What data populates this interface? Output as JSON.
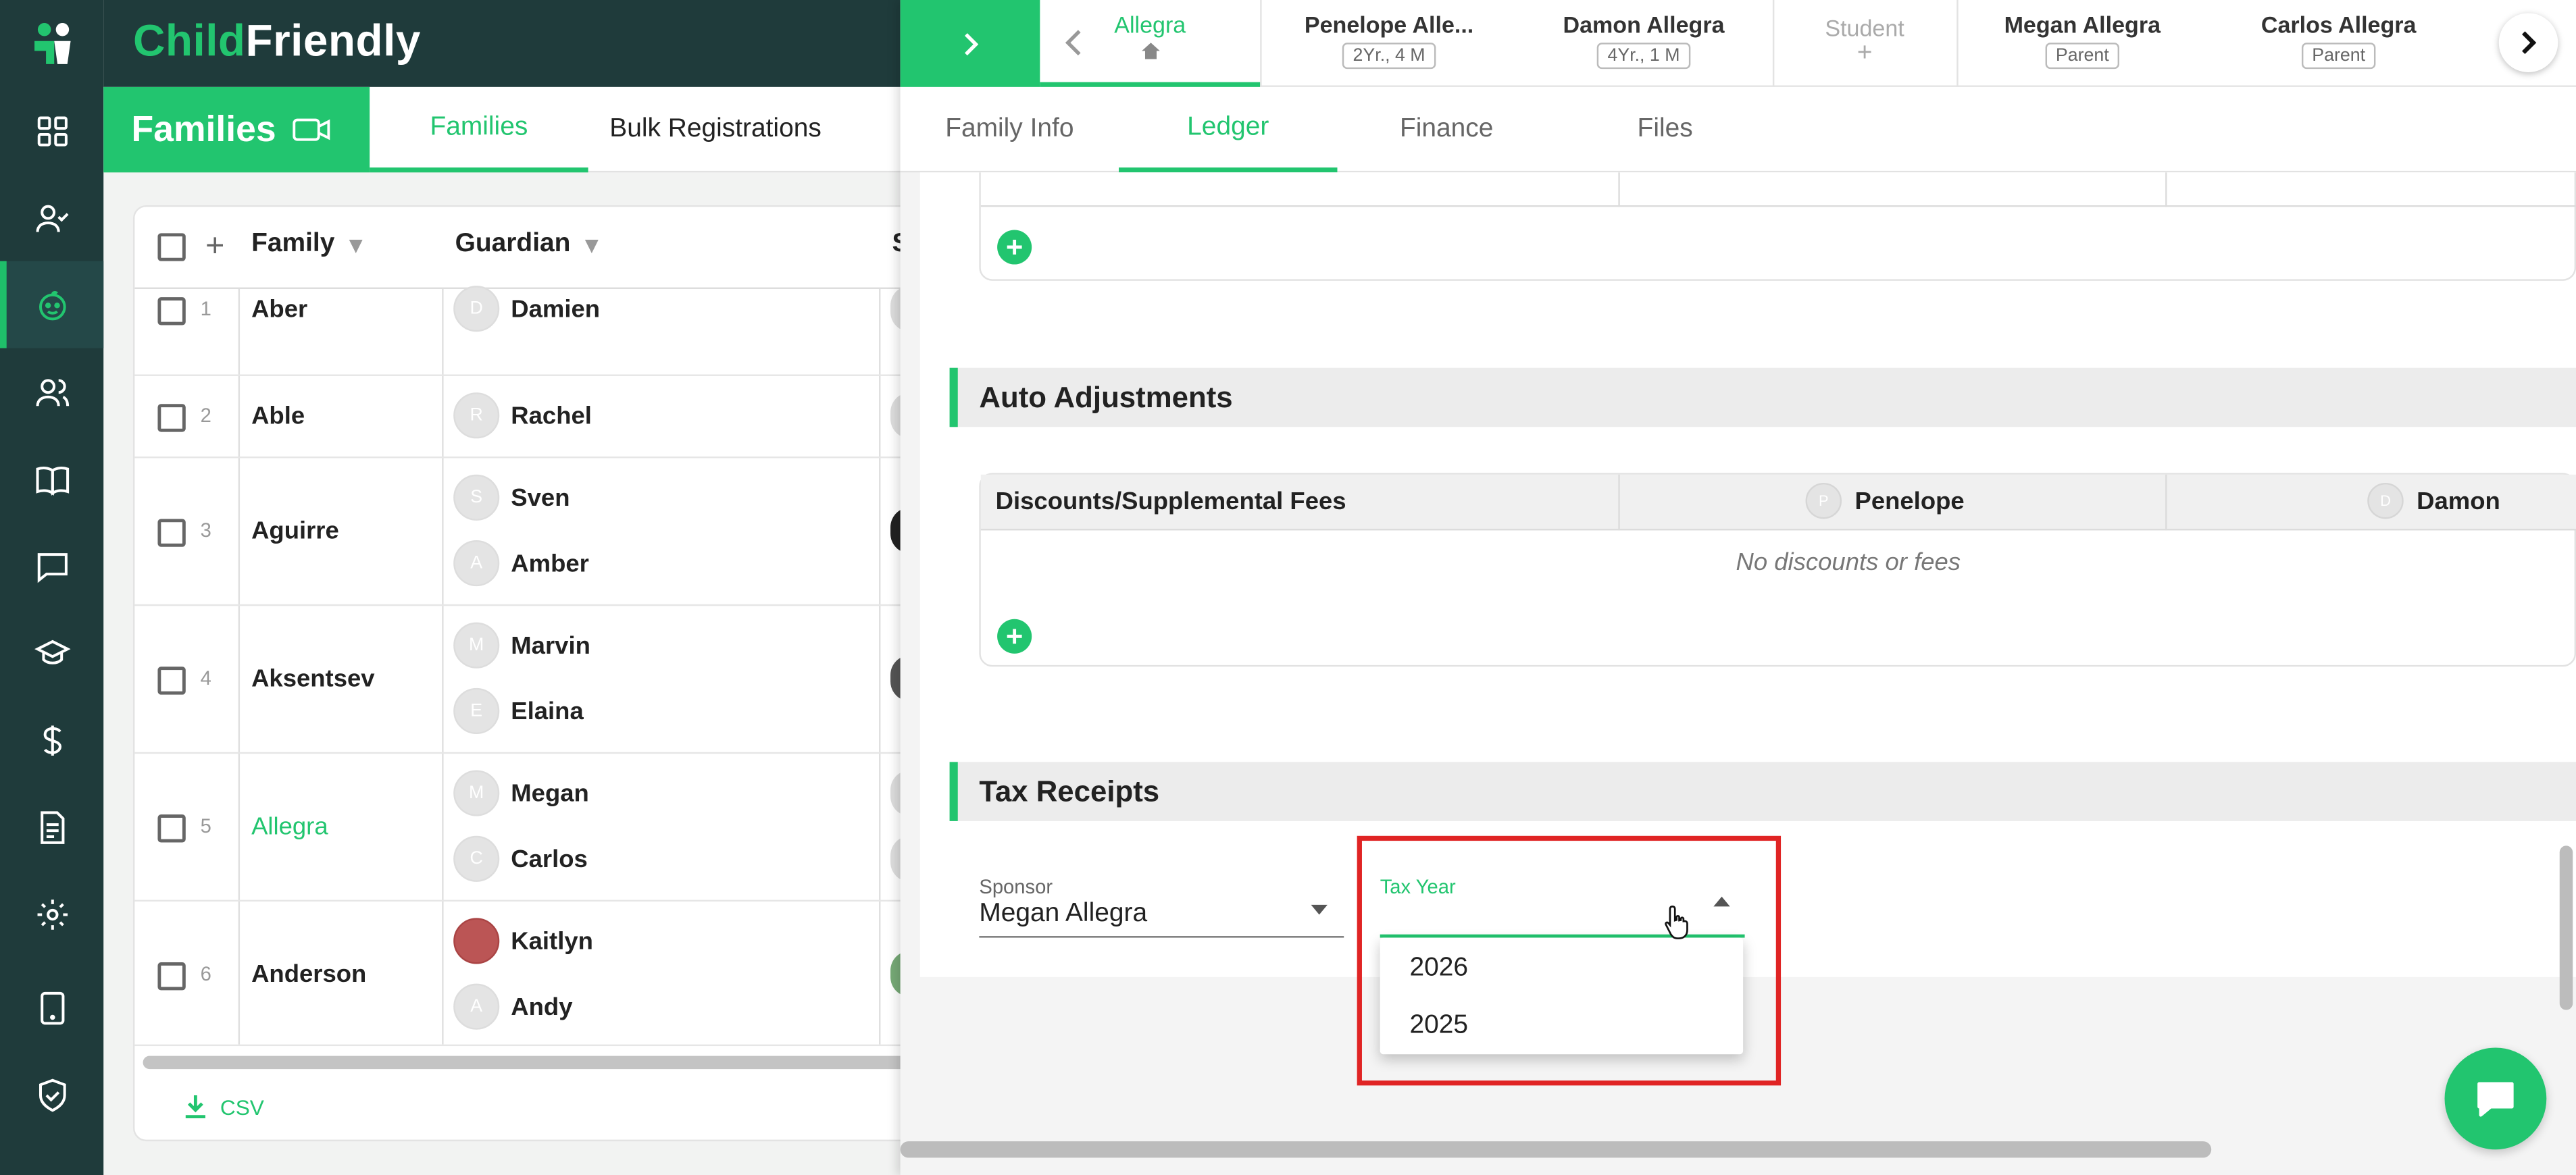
{
  "brand": {
    "part1": "Child",
    "part2": "Friendly"
  },
  "rail": {
    "items": [
      "dashboard-icon",
      "person-check-icon",
      "child-face-icon",
      "people-icon",
      "book-icon",
      "chat-icon",
      "graduation-cap-icon",
      "dollar-icon",
      "document-icon",
      "gear-icon",
      "tablet-icon",
      "shield-check-icon"
    ]
  },
  "families_header": {
    "title": "Families",
    "tabs": [
      "Families",
      "Bulk Registrations"
    ]
  },
  "table": {
    "columns": {
      "family": "Family",
      "guardian": "Guardian",
      "next_col_initial": "S"
    },
    "rows": [
      {
        "num": "1",
        "family": "Aber",
        "guardians": [
          {
            "initial": "D",
            "name": "Damien"
          }
        ]
      },
      {
        "num": "2",
        "family": "Able",
        "guardians": [
          {
            "initial": "R",
            "name": "Rachel"
          }
        ]
      },
      {
        "num": "3",
        "family": "Aguirre",
        "guardians": [
          {
            "initial": "S",
            "name": "Sven"
          },
          {
            "initial": "A",
            "name": "Amber"
          }
        ]
      },
      {
        "num": "4",
        "family": "Aksentsev",
        "guardians": [
          {
            "initial": "M",
            "name": "Marvin"
          },
          {
            "initial": "E",
            "name": "Elaina"
          }
        ]
      },
      {
        "num": "5",
        "family": "Allegra",
        "guardians": [
          {
            "initial": "M",
            "name": "Megan"
          },
          {
            "initial": "C",
            "name": "Carlos"
          }
        ]
      },
      {
        "num": "6",
        "family": "Anderson",
        "guardians": [
          {
            "initial": "",
            "name": "Kaitlyn"
          },
          {
            "initial": "A",
            "name": "Andy"
          }
        ]
      }
    ],
    "csv_label": "CSV"
  },
  "person_tabs": [
    {
      "name": "Allegra",
      "badge": ""
    },
    {
      "name": "Penelope Alle...",
      "badge": "2Yr., 4 M"
    },
    {
      "name": "Damon Allegra",
      "badge": "4Yr., 1 M"
    },
    {
      "name": "Student",
      "badge": "+"
    },
    {
      "name": "Megan Allegra",
      "badge": "Parent"
    },
    {
      "name": "Carlos Allegra",
      "badge": "Parent"
    }
  ],
  "sub_tabs": [
    "Family Info",
    "Ledger",
    "Finance",
    "Files"
  ],
  "auto_adjustments": {
    "title": "Auto Adjustments",
    "col_fees": "Discounts/Supplemental Fees",
    "col_child1": {
      "initial": "P",
      "name": "Penelope"
    },
    "col_child2": {
      "initial": "D",
      "name": "Damon"
    },
    "empty_text": "No discounts or fees"
  },
  "tax_receipts": {
    "title": "Tax Receipts",
    "sponsor_label": "Sponsor",
    "sponsor_value": "Megan Allegra",
    "tax_year_label": "Tax Year",
    "options": [
      "2026",
      "2025"
    ]
  },
  "colors": {
    "accent": "#22c56f",
    "dark": "#1f3b3b",
    "highlight": "#e02424"
  }
}
